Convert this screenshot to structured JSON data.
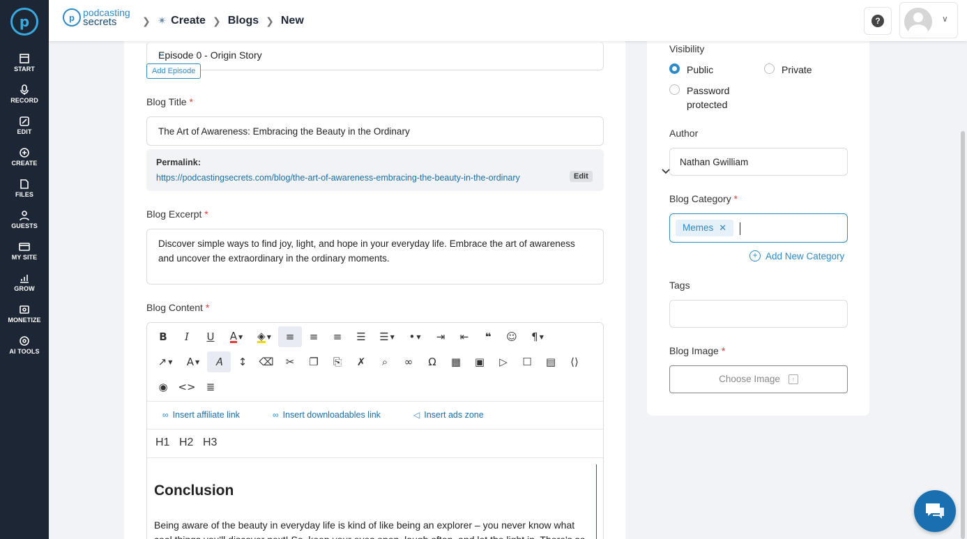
{
  "sidebar": {
    "logo": "p",
    "items": [
      {
        "label": "START",
        "icon": "start-icon"
      },
      {
        "label": "RECORD",
        "icon": "microphone-icon"
      },
      {
        "label": "EDIT",
        "icon": "edit-icon"
      },
      {
        "label": "CREATE",
        "icon": "create-icon"
      },
      {
        "label": "FILES",
        "icon": "files-icon"
      },
      {
        "label": "GUESTS",
        "icon": "guests-icon"
      },
      {
        "label": "MY SITE",
        "icon": "my-site-icon"
      },
      {
        "label": "GROW",
        "icon": "grow-icon"
      },
      {
        "label": "MONETIZE",
        "icon": "monetize-icon"
      },
      {
        "label": "AI TOOLS",
        "icon": "ai-tools-icon"
      }
    ]
  },
  "header": {
    "brand_line1": "podcasting",
    "brand_line2": "secrets",
    "breadcrumb": [
      "Create",
      "Blogs",
      "New"
    ]
  },
  "form": {
    "episode_value": "Episode 0 - Origin Story",
    "add_episode_label": "Add Episode",
    "blog_title_label": "Blog Title",
    "blog_title_value": "The Art of Awareness: Embracing the Beauty in the Ordinary",
    "permalink_label": "Permalink:",
    "permalink_url": "https://podcastingsecrets.com/blog/the-art-of-awareness-embracing-the-beauty-in-the-ordinary",
    "permalink_edit": "Edit",
    "excerpt_label": "Blog Excerpt",
    "excerpt_value": "Discover simple ways to find joy, light, and hope in your everyday life. Embrace the art of awareness and uncover the extraordinary in the ordinary moments.",
    "content_label": "Blog Content",
    "required_mark": "*"
  },
  "editor": {
    "insert_affiliate": "Insert affiliate link",
    "insert_downloadables": "Insert downloadables link",
    "insert_ads": "Insert ads zone",
    "h1": "H1",
    "h2": "H2",
    "h3": "H3",
    "content_heading": "Conclusion",
    "content_paragraph": "Being aware of the beauty in everyday life is kind of like being an explorer – you never know what cool things you'll discover next! So, keep your eyes open, laugh often, and let the light in. There's so"
  },
  "side": {
    "visibility_label": "Visibility",
    "visibility_options": [
      "Public",
      "Private",
      "Password protected"
    ],
    "visibility_selected": "Public",
    "author_label": "Author",
    "author_value": "Nathan Gwilliam",
    "category_label": "Blog Category",
    "category_chip": "Memes",
    "add_category": "Add New Category",
    "tags_label": "Tags",
    "image_label": "Blog Image",
    "choose_image": "Choose Image"
  },
  "colors": {
    "accent": "#2c8ac7",
    "sidebar_bg": "#1d2634",
    "required": "#e53935"
  }
}
